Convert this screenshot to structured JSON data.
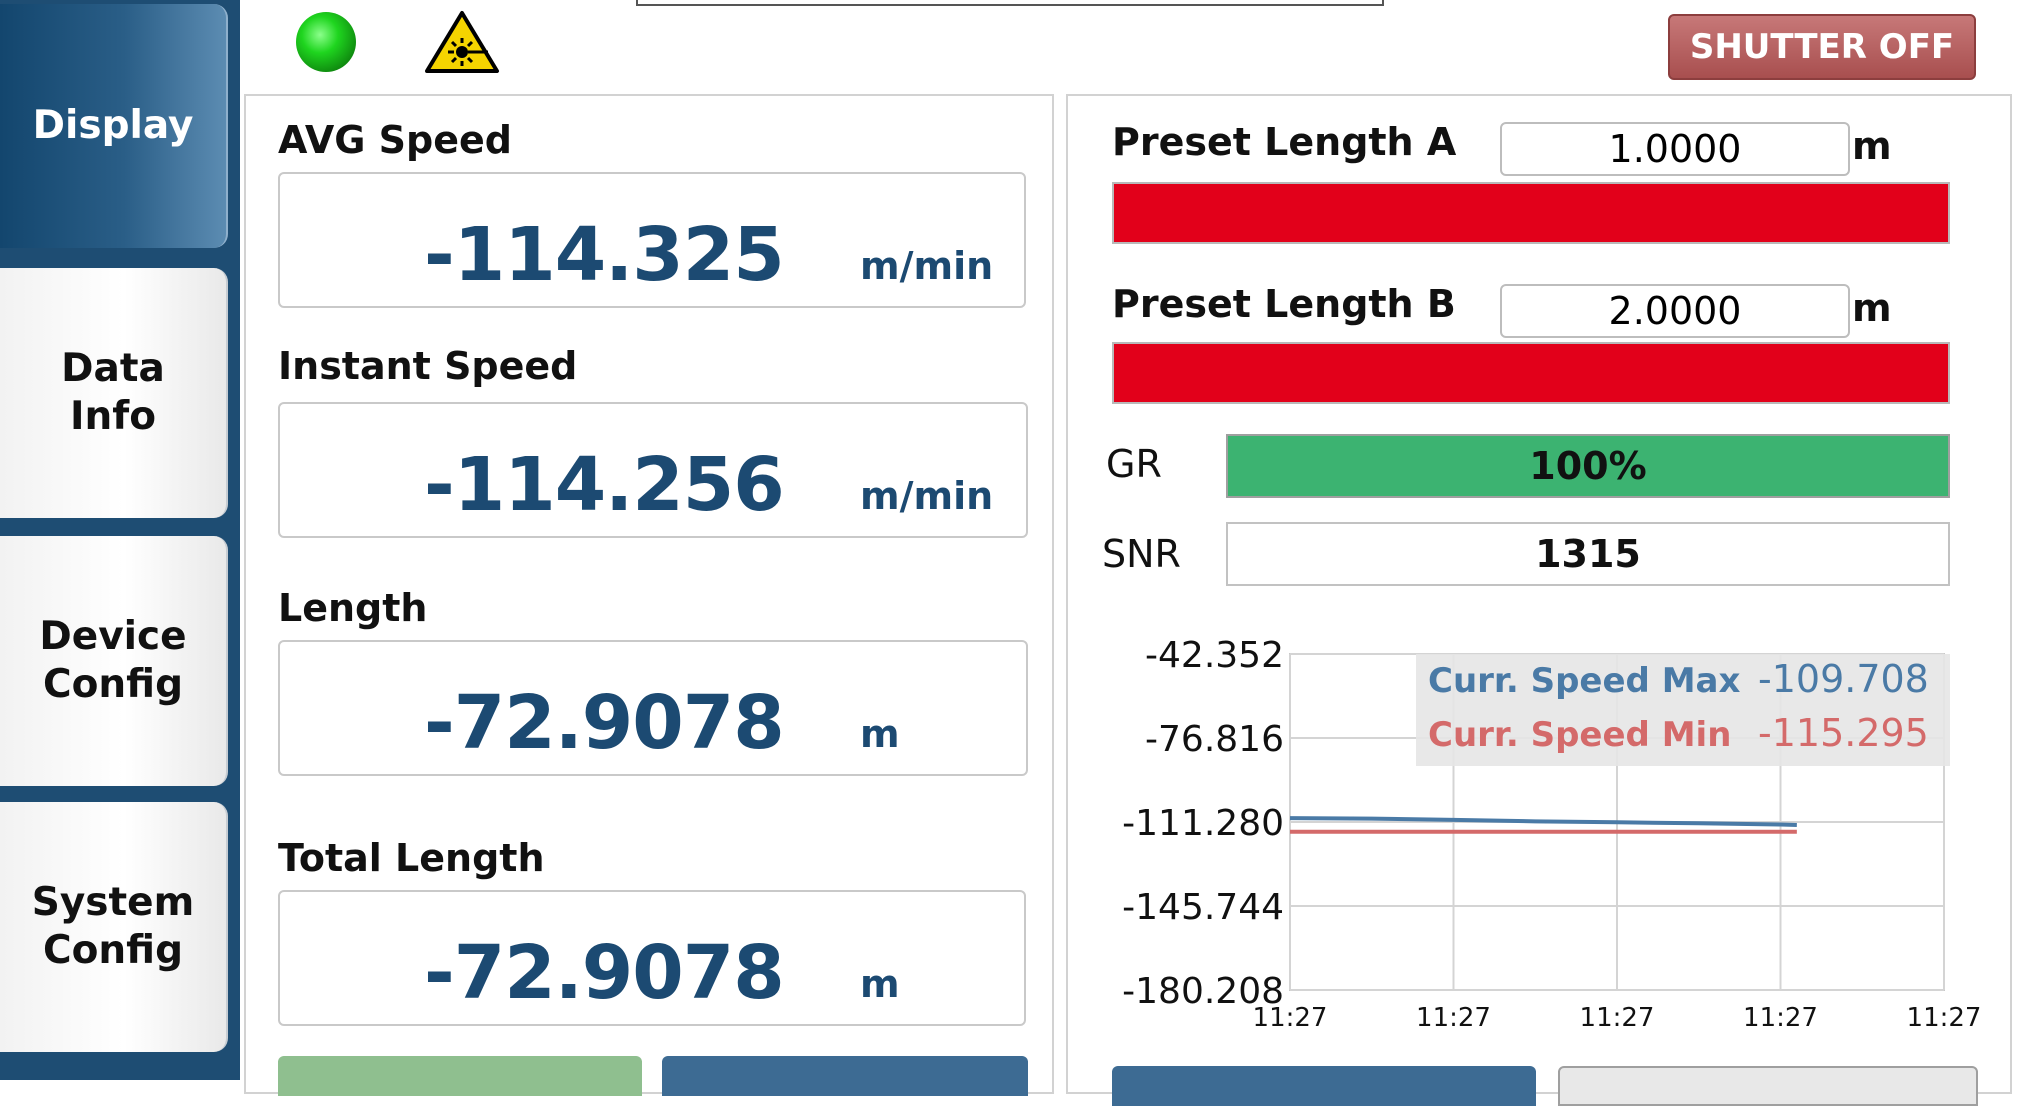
{
  "sidebar": {
    "tabs": [
      {
        "label": "Display",
        "active": true
      },
      {
        "label": "Data\nInfo",
        "active": false
      },
      {
        "label": "Device\nConfig",
        "active": false
      },
      {
        "label": "System\nConfig",
        "active": false
      }
    ]
  },
  "status": {
    "led_color": "#1fd51f",
    "laser_icon": "laser-warning-icon"
  },
  "header": {
    "shutter_label": "SHUTTER OFF"
  },
  "measurements": {
    "avg_speed": {
      "label": "AVG Speed",
      "value": "-114.325",
      "unit": "m/min"
    },
    "instant_speed": {
      "label": "Instant Speed",
      "value": "-114.256",
      "unit": "m/min"
    },
    "length": {
      "label": "Length",
      "value": "-72.9078",
      "unit": "m"
    },
    "total_length": {
      "label": "Total Length",
      "value": "-72.9078",
      "unit": "m"
    }
  },
  "presets": {
    "a": {
      "label": "Preset Length A",
      "value": "1.0000",
      "unit": "m"
    },
    "b": {
      "label": "Preset Length B",
      "value": "2.0000",
      "unit": "m"
    }
  },
  "signal": {
    "gr_label": "GR",
    "gr_text": "100%",
    "gr_fraction": 1.0,
    "snr_label": "SNR",
    "snr_value": "1315"
  },
  "colors": {
    "accent": "#1c4a72",
    "preset_bar": "#e2001a",
    "gr_fill": "#3cb371",
    "max_series": "#4a7aa6",
    "min_series": "#d46a6a",
    "shutter_button": "#b05a5a"
  },
  "chart_data": {
    "type": "line",
    "y_ticks": [
      "-42.352",
      "-76.816",
      "-111.280",
      "-145.744",
      "-180.208"
    ],
    "ylim": [
      -180.208,
      -42.352
    ],
    "x_ticks": [
      "11:27",
      "11:27",
      "11:27",
      "11:27",
      "11:27"
    ],
    "grid": true,
    "legend_position": "top-right",
    "legend": [
      {
        "name": "Curr. Speed Max",
        "value": "-109.708"
      },
      {
        "name": "Curr. Speed Min",
        "value": "-115.295"
      }
    ],
    "series": [
      {
        "name": "Curr. Speed Max",
        "x": [
          0,
          0.5,
          1.0,
          1.5,
          2.0,
          2.5,
          3.0,
          3.1
        ],
        "values": [
          -109.7,
          -109.9,
          -110.4,
          -111.0,
          -111.4,
          -111.8,
          -112.3,
          -112.5
        ]
      },
      {
        "name": "Curr. Speed Min",
        "x": [
          0,
          0.5,
          1.0,
          1.5,
          2.0,
          2.5,
          3.0,
          3.1
        ],
        "values": [
          -115.3,
          -115.3,
          -115.3,
          -115.3,
          -115.3,
          -115.3,
          -115.3,
          -115.3
        ]
      }
    ],
    "xlim": [
      0,
      4
    ]
  },
  "bottom_buttons": [
    {
      "name": "left-green-button",
      "color": "#8fbf8f"
    },
    {
      "name": "left-blue-button",
      "color": "#3d6b93"
    },
    {
      "name": "right-blue-button",
      "color": "#3d6b93"
    },
    {
      "name": "right-gray-button",
      "color": "#e8e8e8"
    }
  ]
}
